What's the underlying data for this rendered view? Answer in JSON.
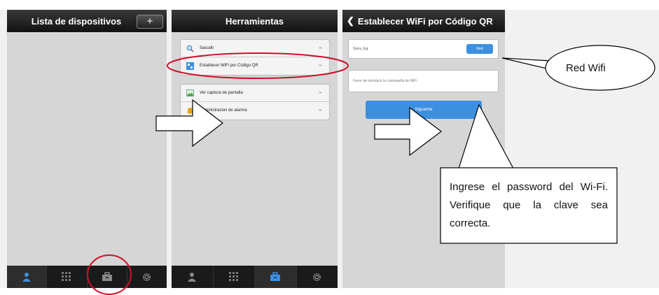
{
  "screen1": {
    "title": "Lista de dispositivos",
    "add_label": "+"
  },
  "screen2": {
    "title": "Herramientas",
    "items": [
      {
        "label": "Sacudir",
        "icon": "magnifier-icon"
      },
      {
        "label": "Establecer WiFi por Código QR",
        "icon": "qr-icon"
      },
      {
        "label": "Ver captura de pantalla",
        "icon": "picture-icon"
      },
      {
        "label": "Administracion de alarma",
        "icon": "bell-icon"
      }
    ],
    "chevron": "≫"
  },
  "screen3": {
    "back_glyph": "❮",
    "title": "Establecer WiFi por Código QR",
    "ssid_value": "Siera_Ing",
    "red_button": "Red",
    "password_placeholder": "Favor de introducir la contraseña de WiFi",
    "next_button": "Siguiente"
  },
  "annotations": {
    "red_wifi": "Red Wifi",
    "password_note": "Ingrese el password del Wi-Fi. Verifique que la clave sea correcta."
  },
  "colors": {
    "accent_blue": "#3d8fe0",
    "highlight_red": "#d0102a",
    "bar_dark": "#1a1a1a",
    "screen_bg": "#d6d6d6"
  }
}
